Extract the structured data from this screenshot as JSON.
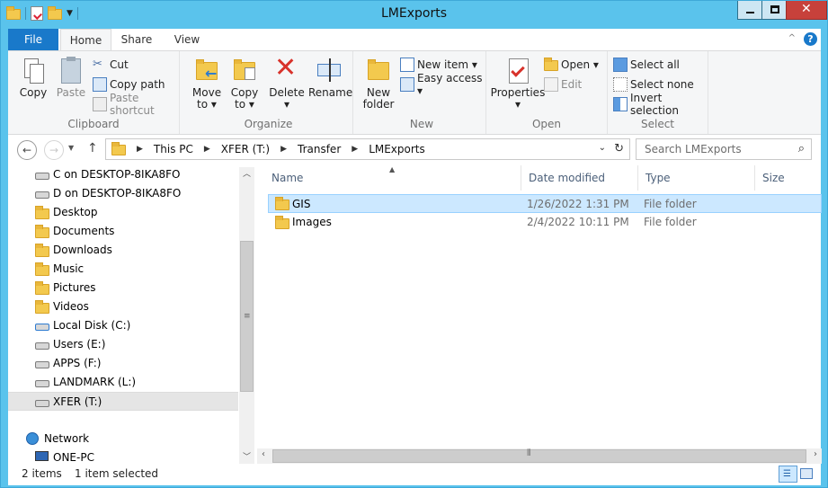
{
  "window": {
    "title": "LMExports"
  },
  "ribbon_tabs": [
    "File",
    "Home",
    "Share",
    "View"
  ],
  "clipboard": {
    "copy": "Copy",
    "paste": "Paste",
    "cut": "Cut",
    "copy_path": "Copy path",
    "paste_shortcut": "Paste shortcut",
    "label": "Clipboard"
  },
  "organize": {
    "move_to_1": "Move",
    "move_to_2": "to ▾",
    "copy_to_1": "Copy",
    "copy_to_2": "to ▾",
    "delete": "Delete",
    "delete_arrow": "▾",
    "rename": "Rename",
    "label": "Organize"
  },
  "new": {
    "new_folder_1": "New",
    "new_folder_2": "folder",
    "new_item": "New item ▾",
    "easy_access": "Easy access ▾",
    "label": "New"
  },
  "open": {
    "properties": "Properties",
    "properties_arrow": "▾",
    "open": "Open ▾",
    "edit": "Edit",
    "label": "Open"
  },
  "select": {
    "select_all": "Select all",
    "select_none": "Select none",
    "invert": "Invert selection",
    "label": "Select"
  },
  "address": {
    "crumbs": [
      "This PC",
      "XFER (T:)",
      "Transfer",
      "LMExports"
    ]
  },
  "search": {
    "placeholder": "Search LMExports"
  },
  "nav": [
    {
      "label": "C on DESKTOP-8IKA8FO",
      "icon": "network-drive-icon"
    },
    {
      "label": "D on DESKTOP-8IKA8FO",
      "icon": "network-drive-icon"
    },
    {
      "label": "Desktop",
      "icon": "desktop-folder-icon"
    },
    {
      "label": "Documents",
      "icon": "documents-folder-icon"
    },
    {
      "label": "Downloads",
      "icon": "downloads-folder-icon"
    },
    {
      "label": "Music",
      "icon": "music-folder-icon"
    },
    {
      "label": "Pictures",
      "icon": "pictures-folder-icon"
    },
    {
      "label": "Videos",
      "icon": "videos-folder-icon"
    },
    {
      "label": "Local Disk (C:)",
      "icon": "windows-drive-icon"
    },
    {
      "label": "Users (E:)",
      "icon": "drive-icon"
    },
    {
      "label": "APPS (F:)",
      "icon": "drive-icon"
    },
    {
      "label": "LANDMARK (L:)",
      "icon": "drive-icon"
    },
    {
      "label": "XFER (T:)",
      "icon": "drive-icon"
    },
    {
      "label": "Network",
      "icon": "network-icon"
    },
    {
      "label": "ONE-PC",
      "icon": "computer-icon"
    }
  ],
  "columns": [
    "Name",
    "Date modified",
    "Type",
    "Size"
  ],
  "files": [
    {
      "name": "GIS",
      "date": "1/26/2022 1:31 PM",
      "type": "File folder",
      "size": ""
    },
    {
      "name": "Images",
      "date": "2/4/2022 10:11 PM",
      "type": "File folder",
      "size": ""
    }
  ],
  "status": {
    "items": "2 items",
    "selected": "1 item selected"
  },
  "colors": {
    "titlebar": "#5ac3ec",
    "file_tab": "#1979ca",
    "selection": "#cce8ff",
    "close": "#c7413b"
  }
}
